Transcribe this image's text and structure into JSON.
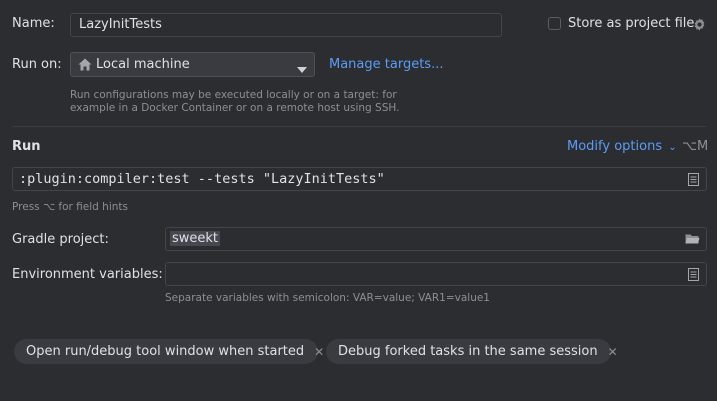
{
  "name": {
    "label": "Name:",
    "value": "LazyInitTests"
  },
  "store_as_project_file": {
    "label": "Store as project file",
    "checked": false
  },
  "run_on": {
    "label": "Run on:",
    "value": "Local machine",
    "manage_targets": "Manage targets...",
    "description_line1": "Run configurations may be executed locally or on a target: for",
    "description_line2": "example in a Docker Container or on a remote host using SSH."
  },
  "run_section": {
    "title": "Run",
    "modify_options": "Modify options",
    "shortcut": "⌥M",
    "command": ":plugin:compiler:test --tests \"LazyInitTests\"",
    "field_hint": "Press ⌥ for field hints"
  },
  "gradle_project": {
    "label": "Gradle project:",
    "value": "sweekt"
  },
  "env_vars": {
    "label": "Environment variables:",
    "value": "",
    "hint": "Separate variables with semicolon: VAR=value; VAR1=value1"
  },
  "chips": [
    {
      "label": "Open run/debug tool window when started"
    },
    {
      "label": "Debug forked tasks in the same session"
    }
  ],
  "icons": {
    "settings": "gear-icon",
    "machine": "house-icon",
    "dropdown": "triangle-down-icon",
    "expand": "list-expand-icon",
    "folder": "folder-icon",
    "close": "close-icon"
  }
}
